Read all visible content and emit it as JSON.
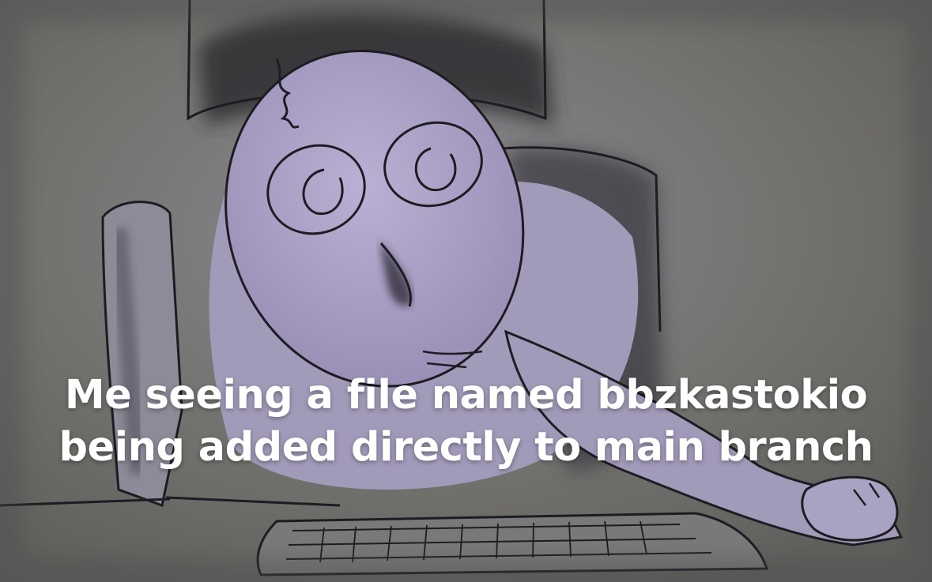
{
  "caption": {
    "line1": "Me seeing a file named bbzkastokio",
    "line2": "being added directly to main branch",
    "color": "#ffffff"
  },
  "colors": {
    "background": "#6d6d6a",
    "figure_fill": "#a59cbf",
    "figure_light": "#b7aed0",
    "outline": "#1e1c22",
    "shadow": "#3a3840"
  }
}
